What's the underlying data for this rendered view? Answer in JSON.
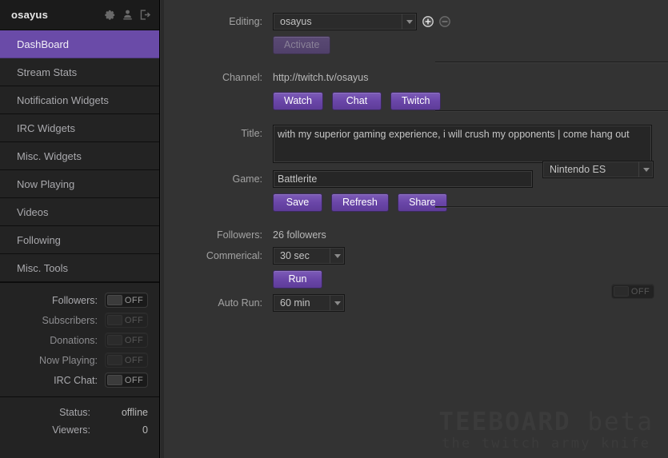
{
  "app": {
    "brand": "osayus",
    "watermark_title_main": "TEEBOARD",
    "watermark_title_beta": "beta",
    "watermark_tagline": "the twitch army knife",
    "accent_purple": "#6a4ba8",
    "button_purple": "#6a46a8",
    "background": "#333333",
    "sidebar_background": "#232323"
  },
  "sidebar": {
    "header_icons": [
      {
        "name": "gear-icon",
        "title": "Settings"
      },
      {
        "name": "user-download-icon",
        "title": "Account"
      },
      {
        "name": "logout-icon",
        "title": "Log out"
      }
    ],
    "items": [
      {
        "label": "DashBoard",
        "active": true
      },
      {
        "label": "Stream Stats",
        "active": false
      },
      {
        "label": "Notification Widgets",
        "active": false
      },
      {
        "label": "IRC Widgets",
        "active": false
      },
      {
        "label": "Misc. Widgets",
        "active": false
      },
      {
        "label": "Now Playing",
        "active": false
      },
      {
        "label": "Videos",
        "active": false
      },
      {
        "label": "Following",
        "active": false
      },
      {
        "label": "Misc. Tools",
        "active": false
      }
    ],
    "toggles": [
      {
        "label": "Followers:",
        "state": "OFF",
        "enabled": true
      },
      {
        "label": "Subscribers:",
        "state": "OFF",
        "enabled": false
      },
      {
        "label": "Donations:",
        "state": "OFF",
        "enabled": false
      },
      {
        "label": "Now Playing:",
        "state": "OFF",
        "enabled": false
      },
      {
        "label": "IRC Chat:",
        "state": "OFF",
        "enabled": true
      }
    ],
    "status": [
      {
        "label": "Status:",
        "value": "offline"
      },
      {
        "label": "Viewers:",
        "value": "0"
      }
    ]
  },
  "dashboard": {
    "editing": {
      "label": "Editing:",
      "value": "osayus",
      "options": [
        "osayus"
      ],
      "add_icon": "plus-circle-icon",
      "remove_icon": "minus-circle-icon",
      "activate_label": "Activate",
      "activate_disabled": true
    },
    "channel": {
      "label": "Channel:",
      "url": "http://twitch.tv/osayus",
      "buttons": [
        "Watch",
        "Chat",
        "Twitch"
      ]
    },
    "title": {
      "label": "Title:",
      "value": "with my superior gaming experience, i will crush my opponents | come hang out"
    },
    "game": {
      "label": "Game:",
      "value": "Battlerite",
      "platform_value": "Nintendo ES",
      "platform_options": [
        "Nintendo ES"
      ],
      "buttons": [
        "Save",
        "Refresh",
        "Share"
      ]
    },
    "followers": {
      "label": "Followers:",
      "value": "26 followers"
    },
    "commercial": {
      "label": "Commerical:",
      "value": "30 sec",
      "options": [
        "30 sec"
      ],
      "run_label": "Run"
    },
    "auto_run": {
      "label": "Auto Run:",
      "value": "60 min",
      "options": [
        "60 min"
      ],
      "toggle_state": "OFF"
    }
  }
}
